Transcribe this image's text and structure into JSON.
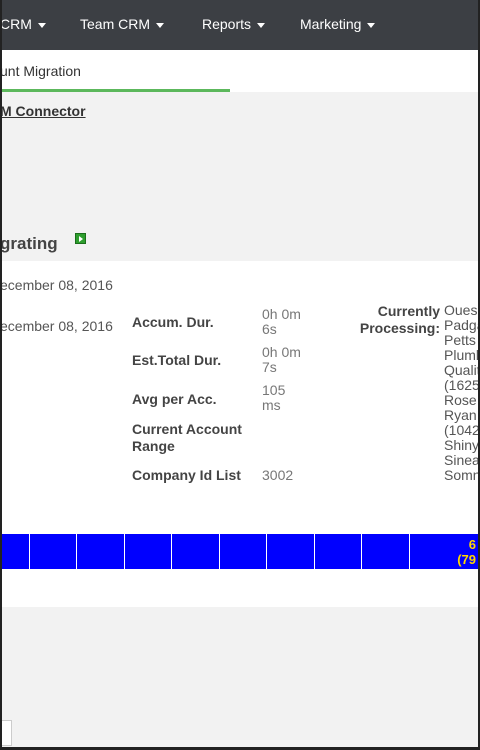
{
  "nav": {
    "items": [
      {
        "label": "CRM"
      },
      {
        "label": "Team CRM"
      },
      {
        "label": "Reports"
      },
      {
        "label": "Marketing"
      }
    ]
  },
  "tab": {
    "active_label": "unt Migration"
  },
  "breadcrumb": {
    "label": "M Connector"
  },
  "section": {
    "title": "grating"
  },
  "stats": {
    "start_date": "ecember 08, 2016",
    "end_date": "ecember 08, 2016",
    "accum_dur_label": "Accum. Dur.",
    "accum_dur_value_1": "0h 0m",
    "accum_dur_value_2": "6s",
    "est_total_label": "Est.Total Dur.",
    "est_total_value_1": "0h 0m",
    "est_total_value_2": "7s",
    "avg_label": "Avg per Acc.",
    "avg_value_1": "105",
    "avg_value_2": "ms",
    "range_label_1": "Current Account",
    "range_label_2": "Range",
    "company_label": "Company Id List",
    "company_value": "3002",
    "processing_label_1": "Currently",
    "processing_label_2": "Processing:",
    "processing_first": "Oues"
  },
  "companies": [
    "Padga",
    "Petts",
    "Plumb",
    "Qualit",
    "(1625",
    "Rose",
    "Ryan",
    "(1042",
    "Shiny",
    "Sinea",
    "Somn"
  ],
  "progress": {
    "fraction_visible": 1.0,
    "percent_text": "6",
    "count_text": "(79",
    "bar_color": "#0000ff",
    "text_color": "#ffd700"
  }
}
